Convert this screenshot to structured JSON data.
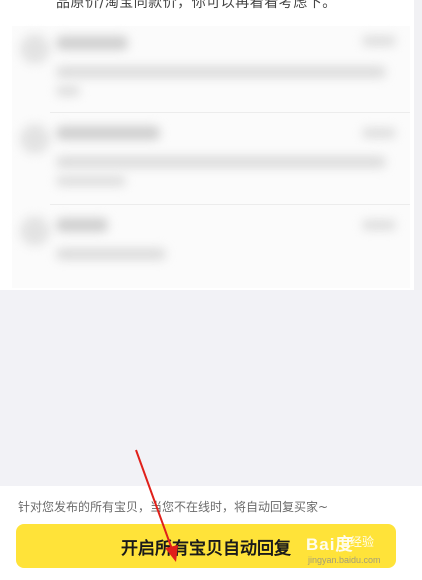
{
  "top_notice": "品原价/淘宝同款价，你可以再看看考虑下。",
  "auto_reply": {
    "hint": "针对您发布的所有宝贝，当您不在线时，将自动回复买家~",
    "enable_button_label": "开启所有宝贝自动回复"
  },
  "watermark": {
    "brand": "Bai度",
    "sub": "经验",
    "url": "jingyan.baidu.com"
  },
  "colors": {
    "button_yellow": "#ffe339",
    "arrow_red": "#e0201a",
    "page_bg": "#f2f2f6"
  }
}
